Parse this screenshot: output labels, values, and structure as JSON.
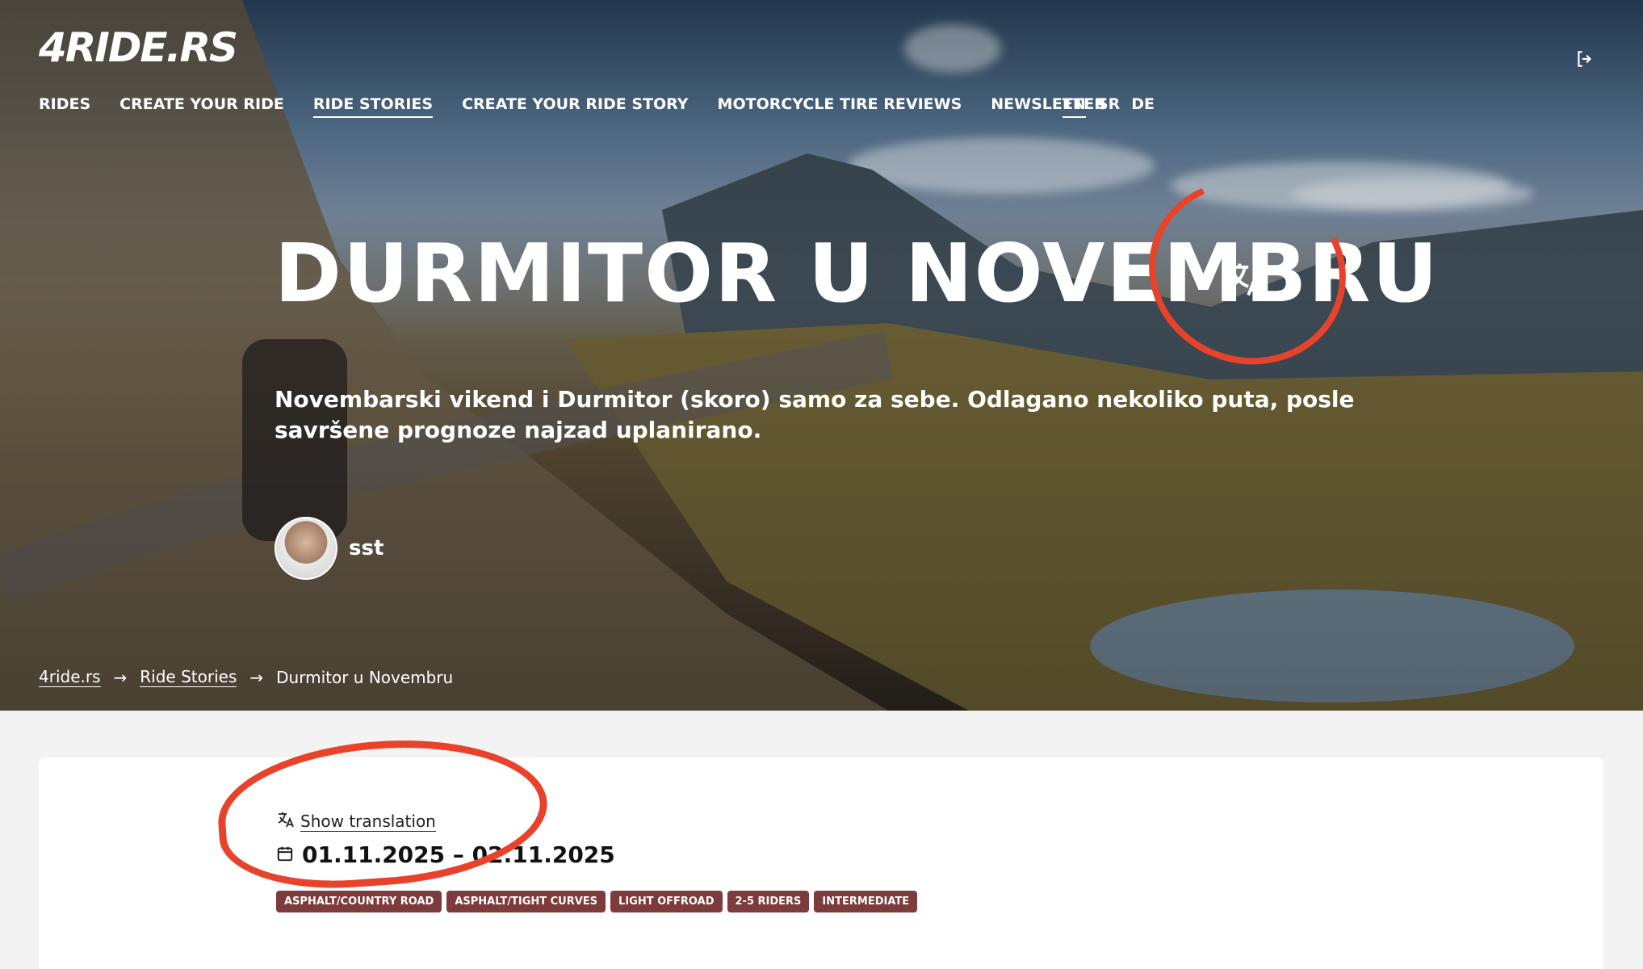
{
  "header": {
    "logo": "4RIDE.RS",
    "nav": [
      "RIDES",
      "CREATE YOUR RIDE",
      "RIDE STORIES",
      "CREATE YOUR RIDE STORY",
      "MOTORCYCLE TIRE REVIEWS",
      "NEWSLETTER"
    ],
    "active_nav": "RIDE STORIES",
    "languages": [
      "EN",
      "SR",
      "DE"
    ],
    "active_language": "EN",
    "logout_icon": "logout-icon"
  },
  "hero": {
    "title": "DURMITOR U NOVEMBRU",
    "translate_icon": "translate-icon",
    "subtitle": "Novembarski vikend i Durmitor (skoro) samo za sebe. Odlagano nekoliko puta, posle savršene prognoze najzad uplanirano.",
    "author": "sst"
  },
  "breadcrumb": {
    "items": [
      "4ride.rs",
      "Ride Stories",
      "Durmitor u Novembru"
    ],
    "separator": "→"
  },
  "content": {
    "show_translation": "Show translation",
    "dates": "01.11.2025 – 02.11.2025",
    "tags": [
      "ASPHALT/COUNTRY ROAD",
      "ASPHALT/TIGHT CURVES",
      "LIGHT OFFROAD",
      "2-5 RIDERS",
      "INTERMEDIATE"
    ]
  },
  "colors": {
    "annotation": "#e8432a",
    "tag_bg": "#7d3b3b",
    "page_bg": "#f3f3f3"
  }
}
